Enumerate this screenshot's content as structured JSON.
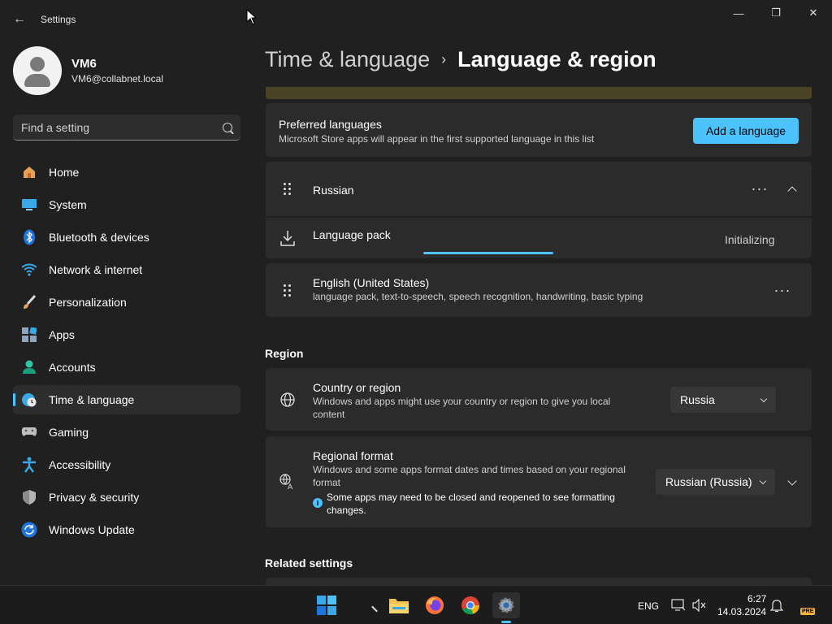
{
  "window": {
    "title": "Settings",
    "back_glyph": "←",
    "minimize_glyph": "—",
    "restore_glyph": "❐",
    "close_glyph": "✕"
  },
  "profile": {
    "name": "VM6",
    "email": "VM6@collabnet.local"
  },
  "search": {
    "placeholder": "Find a setting"
  },
  "sidebar": {
    "items": [
      {
        "label": "Home",
        "icon": "home-icon"
      },
      {
        "label": "System",
        "icon": "system-icon"
      },
      {
        "label": "Bluetooth & devices",
        "icon": "bluetooth-icon"
      },
      {
        "label": "Network & internet",
        "icon": "network-icon"
      },
      {
        "label": "Personalization",
        "icon": "brush-icon"
      },
      {
        "label": "Apps",
        "icon": "apps-icon"
      },
      {
        "label": "Accounts",
        "icon": "accounts-icon"
      },
      {
        "label": "Time & language",
        "icon": "time-language-icon",
        "active": true
      },
      {
        "label": "Gaming",
        "icon": "gaming-icon"
      },
      {
        "label": "Accessibility",
        "icon": "accessibility-icon"
      },
      {
        "label": "Privacy & security",
        "icon": "shield-icon"
      },
      {
        "label": "Windows Update",
        "icon": "update-icon"
      }
    ]
  },
  "breadcrumb": {
    "parent": "Time & language",
    "separator": "›",
    "current": "Language & region"
  },
  "preferred": {
    "title": "Preferred languages",
    "description": "Microsoft Store apps will appear in the first supported language in this list",
    "add_button": "Add a language"
  },
  "languages": {
    "russian": {
      "name": "Russian",
      "more": "···",
      "pack_label": "Language pack",
      "pack_status": "Initializing",
      "pack_progress": 1.0
    },
    "english": {
      "name": "English (United States)",
      "features": "language pack, text-to-speech, speech recognition, handwriting, basic typing",
      "more": "···"
    }
  },
  "region": {
    "heading": "Region",
    "country": {
      "title": "Country or region",
      "description": "Windows and apps might use your country or region to give you local content",
      "value": "Russia"
    },
    "format": {
      "title": "Regional format",
      "description": "Windows and some apps format dates and times based on your regional format",
      "note": "Some apps may need to be closed and reopened to see formatting changes.",
      "value": "Russian (Russia)"
    }
  },
  "related": {
    "heading": "Related settings"
  },
  "taskbar": {
    "language": "ENG",
    "time": "6:27",
    "date": "14.03.2024",
    "badge": "PRE"
  },
  "colors": {
    "accent": "#4cc2ff",
    "background": "#202020",
    "card": "#2b2b2b"
  }
}
